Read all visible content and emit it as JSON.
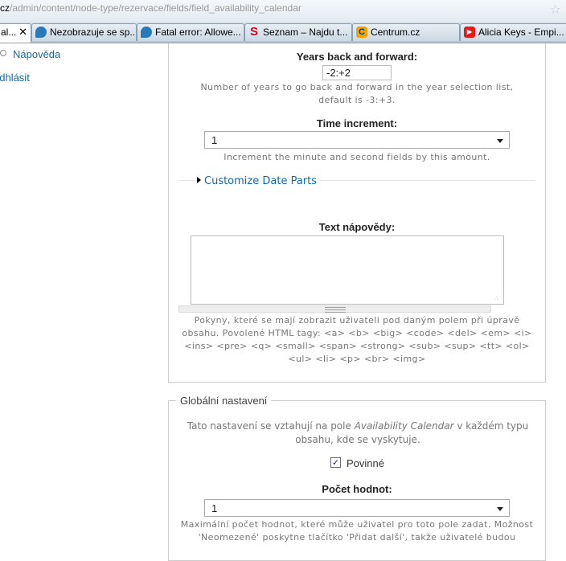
{
  "browser": {
    "url_prefix": "cz",
    "url_path": "/admin/content/node-type/rezervace/fields/field_availability_calendar",
    "tabs": [
      {
        "title": "al...",
        "active": true
      },
      {
        "title": "Nezobrazuje se sp..."
      },
      {
        "title": "Fatal error: Allowe..."
      },
      {
        "title": "Seznam – Najdu t..."
      },
      {
        "title": "Centrum.cz"
      },
      {
        "title": "Alicia Keys - Empi..."
      }
    ]
  },
  "sidebar": {
    "napoveda": "Nápověda",
    "odhlasit": "odhlásit"
  },
  "form": {
    "years_label": "Years back and forward:",
    "years_value": "-2:+2",
    "years_desc": "Number of years to go back and forward in the year selection list, default is -3:+3.",
    "time_label": "Time increment:",
    "time_value": "1",
    "time_desc": "Increment the minute and second fields by this amount.",
    "customize_link": "Customize Date Parts",
    "help_label": "Text nápovědy:",
    "help_value": "",
    "help_desc": "Pokyny, které se mají zobrazit uživateli pod daným polem při úpravě obsahu. Povolené HTML tagy: <a> <b> <big> <code> <del> <em> <i> <ins> <pre> <q> <small> <span> <strong> <sub> <sup> <tt> <ol> <ul> <li> <p> <br> <img>"
  },
  "global": {
    "legend": "Globální nastavení",
    "desc_before": "Tato nastavení se vztahují na pole ",
    "desc_name": "Availability Calendar",
    "desc_after": " v každém typu obsahu, kde se vyskytuje.",
    "required_label": "Povinné",
    "required_checked": true,
    "count_label": "Počet hodnot:",
    "count_value": "1",
    "count_desc": "Maximální počet hodnot, které může uživatel pro toto pole zadat. Možnost 'Neomezené' poskytne tlačítko 'Přidat další', takže uživatelé budou"
  }
}
